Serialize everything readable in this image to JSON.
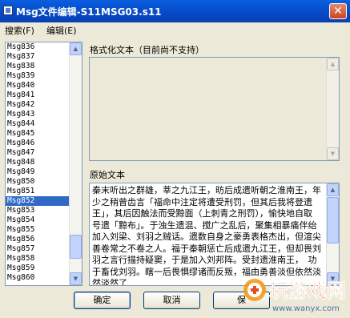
{
  "window": {
    "title": "Msg文件编辑-S11MSG03.s11",
    "close_glyph": "✕"
  },
  "menu": [
    {
      "label": "搜索(F)"
    },
    {
      "label": "编辑(E)"
    }
  ],
  "message_list": {
    "items": [
      "Msg836",
      "Msg837",
      "Msg838",
      "Msg839",
      "Msg840",
      "Msg841",
      "Msg842",
      "Msg843",
      "Msg844",
      "Msg845",
      "Msg846",
      "Msg847",
      "Msg848",
      "Msg849",
      "Msg850",
      "Msg851",
      "Msg852",
      "Msg853",
      "Msg854",
      "Msg855",
      "Msg856",
      "Msg857",
      "Msg858",
      "Msg859",
      "Msg860"
    ],
    "selected_index": 16
  },
  "formatted_text": {
    "label": "格式化文本（目前尚不支持）",
    "value": ""
  },
  "original_text": {
    "label": "原始文本",
    "value": "秦末听出之群雄，莘之九江王，昉后成遗听朝之淮南王，年少之稍曾齿言「福命中注定将遭受刑罚，但其后我将登遗王」，其后因触法而受黥面（上刺青之刑罚），愉快地自取　号遗「黥布」。于浊生遗混、搅广之乱后，聚集相暴痛伴绐加入刘梁、刘羽之贼话。遗数自身之豪勇表格杰出，但渲尖善卷常之不卷之人。福于秦朝惩亡后成遗九江王，但却畏刘羽之言行描持疑窦，于是加入刘邦阵。受封遗淮南王，　功于畜伐刘羽。瞎一后畏惧缪诸而反叛，福由勇善淡但依然淡然淡然了"
  },
  "buttons": {
    "ok": "确定",
    "cancel": "取消",
    "third": "保"
  },
  "watermark": {
    "brand": "玩游戏网",
    "url": "www.wanyx.com"
  }
}
